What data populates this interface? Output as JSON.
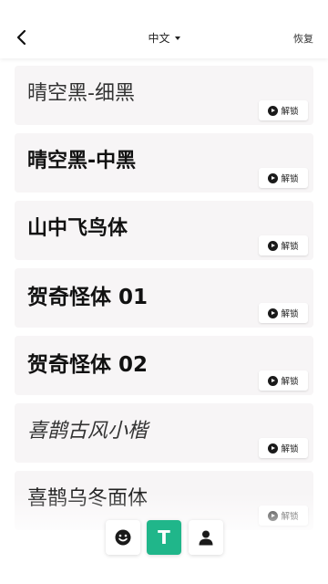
{
  "header": {
    "language": "中文",
    "restore_label": "恢复"
  },
  "fonts": [
    {
      "name": "晴空黑-细黑",
      "unlock_label": "解锁"
    },
    {
      "name": "晴空黑-中黑",
      "unlock_label": "解锁"
    },
    {
      "name": "山中飞鸟体",
      "unlock_label": "解锁"
    },
    {
      "name": "贺奇怪体 01",
      "unlock_label": "解锁"
    },
    {
      "name": "贺奇怪体 02",
      "unlock_label": "解锁"
    },
    {
      "name": "喜鹊古风小楷",
      "unlock_label": "解锁"
    },
    {
      "name": "喜鹊乌冬面体",
      "unlock_label": "解锁"
    }
  ],
  "bottom_bar": {
    "text_tab_label": "T"
  },
  "icons": {
    "back": "chevron-left-icon",
    "unlock": "play-circle-icon",
    "emoji": "smiley-icon",
    "profile": "person-icon"
  },
  "colors": {
    "accent": "#20b68a",
    "card_bg": "#f7f5f6"
  }
}
